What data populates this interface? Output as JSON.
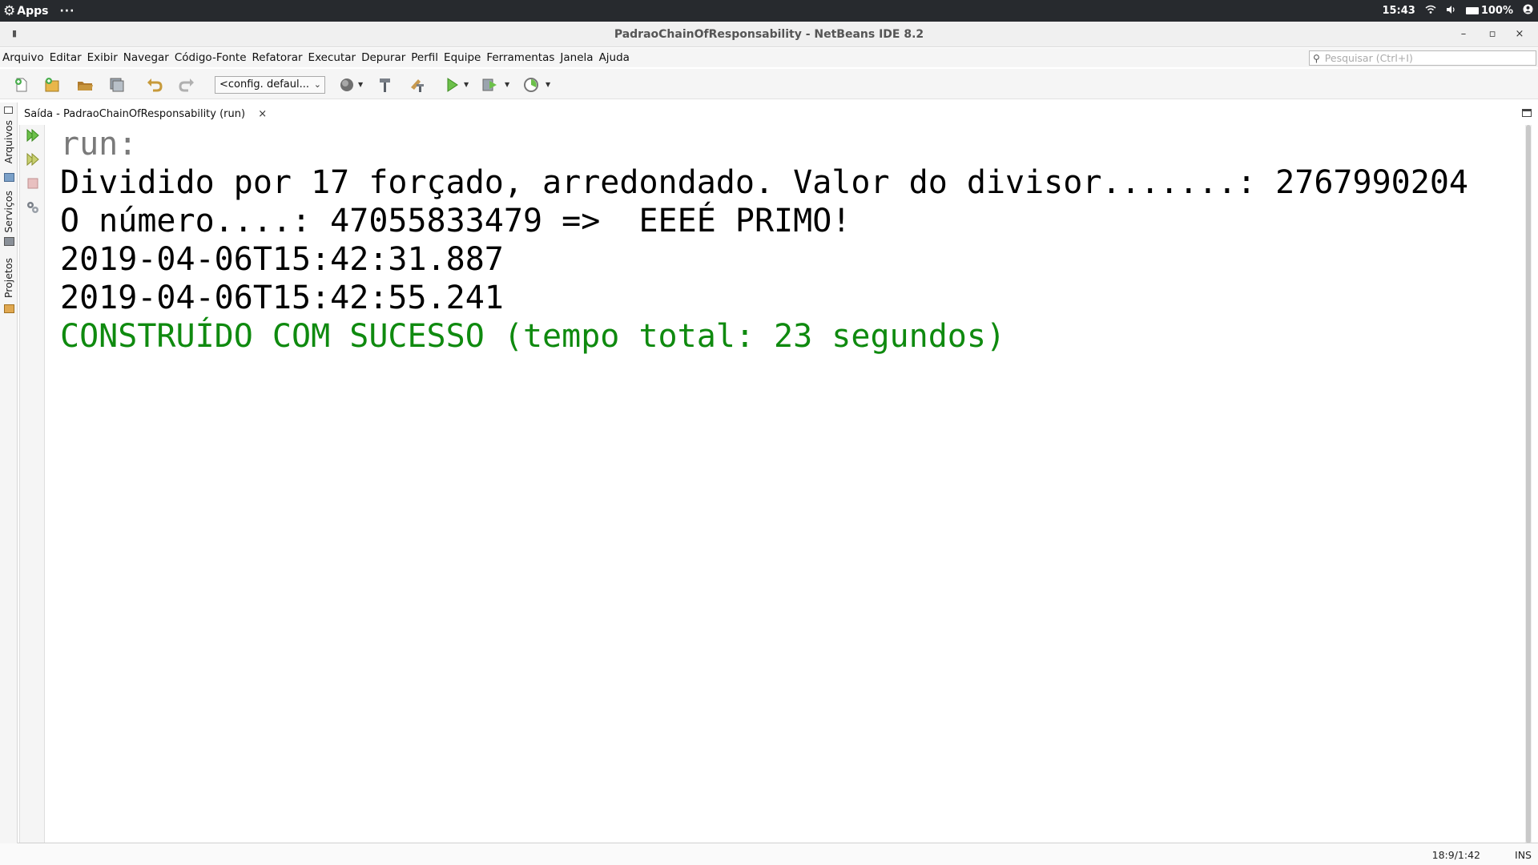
{
  "system_bar": {
    "apps_label": "Apps",
    "more_label": "···",
    "time": "15:43",
    "battery": "100%"
  },
  "window": {
    "title": "PadraoChainOfResponsability - NetBeans IDE 8.2",
    "minimize": "–",
    "maximize": "▫",
    "close": "×"
  },
  "menu": {
    "items": [
      "Arquivo",
      "Editar",
      "Exibir",
      "Navegar",
      "Código-Fonte",
      "Refatorar",
      "Executar",
      "Depurar",
      "Perfil",
      "Equipe",
      "Ferramentas",
      "Janela",
      "Ajuda"
    ]
  },
  "search": {
    "placeholder": "Pesquisar (Ctrl+I)"
  },
  "toolbar": {
    "config_value": "<config. defaul...",
    "icons": [
      "new-file-icon",
      "new-project-icon",
      "open-project-icon",
      "save-all-icon",
      "undo-icon",
      "redo-icon",
      "browser-icon",
      "build-hammer-icon",
      "clean-build-icon",
      "run-icon",
      "debug-icon",
      "profile-icon"
    ]
  },
  "side_panel": {
    "tabs": [
      "Arquivos",
      "Serviços",
      "Projetos"
    ]
  },
  "output_tab": {
    "label": "Saída - PadraoChainOfResponsability (run)",
    "close": "×"
  },
  "output": {
    "lines": [
      {
        "text": "run:",
        "kind": "run"
      },
      {
        "text": "Dividido por 17 forçado, arredondado. Valor do divisor.......: 2767990204",
        "kind": "normal"
      },
      {
        "text": "O número....: 47055833479 =>  EEEÉ PRIMO!",
        "kind": "normal"
      },
      {
        "text": "2019-04-06T15:42:31.887",
        "kind": "normal"
      },
      {
        "text": "2019-04-06T15:42:55.241",
        "kind": "normal"
      },
      {
        "text": "CONSTRUÍDO COM SUCESSO (tempo total: 23 segundos)",
        "kind": "ok"
      }
    ]
  },
  "status": {
    "position": "18:9/1:42",
    "mode": "INS"
  },
  "colors": {
    "success_green": "#0f8a0f",
    "run_gray": "#7a7a7a",
    "system_bar": "#272a2e"
  }
}
